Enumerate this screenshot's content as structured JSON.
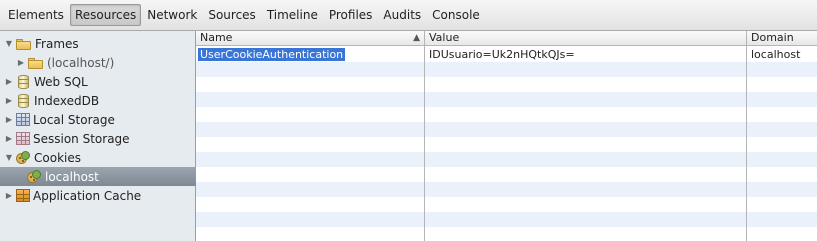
{
  "toolbar": {
    "tabs": [
      {
        "label": "Elements"
      },
      {
        "label": "Resources",
        "selected": true
      },
      {
        "label": "Network"
      },
      {
        "label": "Sources"
      },
      {
        "label": "Timeline"
      },
      {
        "label": "Profiles"
      },
      {
        "label": "Audits"
      },
      {
        "label": "Console"
      }
    ]
  },
  "sidebar": {
    "items": [
      {
        "label": "Frames",
        "icon": "folder-icon",
        "expanded": true
      },
      {
        "label": "(localhost/)",
        "icon": "folder-icon",
        "expanded": false
      },
      {
        "label": "Web SQL",
        "icon": "database-icon",
        "expanded": false
      },
      {
        "label": "IndexedDB",
        "icon": "database-icon",
        "expanded": false
      },
      {
        "label": "Local Storage",
        "icon": "local-storage-icon",
        "expanded": false
      },
      {
        "label": "Session Storage",
        "icon": "session-storage-icon",
        "expanded": false
      },
      {
        "label": "Cookies",
        "icon": "cookies-icon",
        "expanded": true
      },
      {
        "label": "localhost",
        "icon": "cookie-icon",
        "selected": true
      },
      {
        "label": "Application Cache",
        "icon": "application-cache-icon",
        "expanded": false
      }
    ]
  },
  "table": {
    "columns": [
      {
        "label": "Name",
        "sorted": "ascending"
      },
      {
        "label": "Value"
      },
      {
        "label": "Domain"
      }
    ],
    "rows": [
      {
        "name": "UserCookieAuthentication",
        "value": "IDUsuario=Uk2nHQtkQJs=",
        "domain": "localhost"
      }
    ]
  },
  "colors": {
    "selection": "#3875d7",
    "sidebar_bg": "#e6ebf0",
    "row_stripe": "#eaf1fb"
  }
}
